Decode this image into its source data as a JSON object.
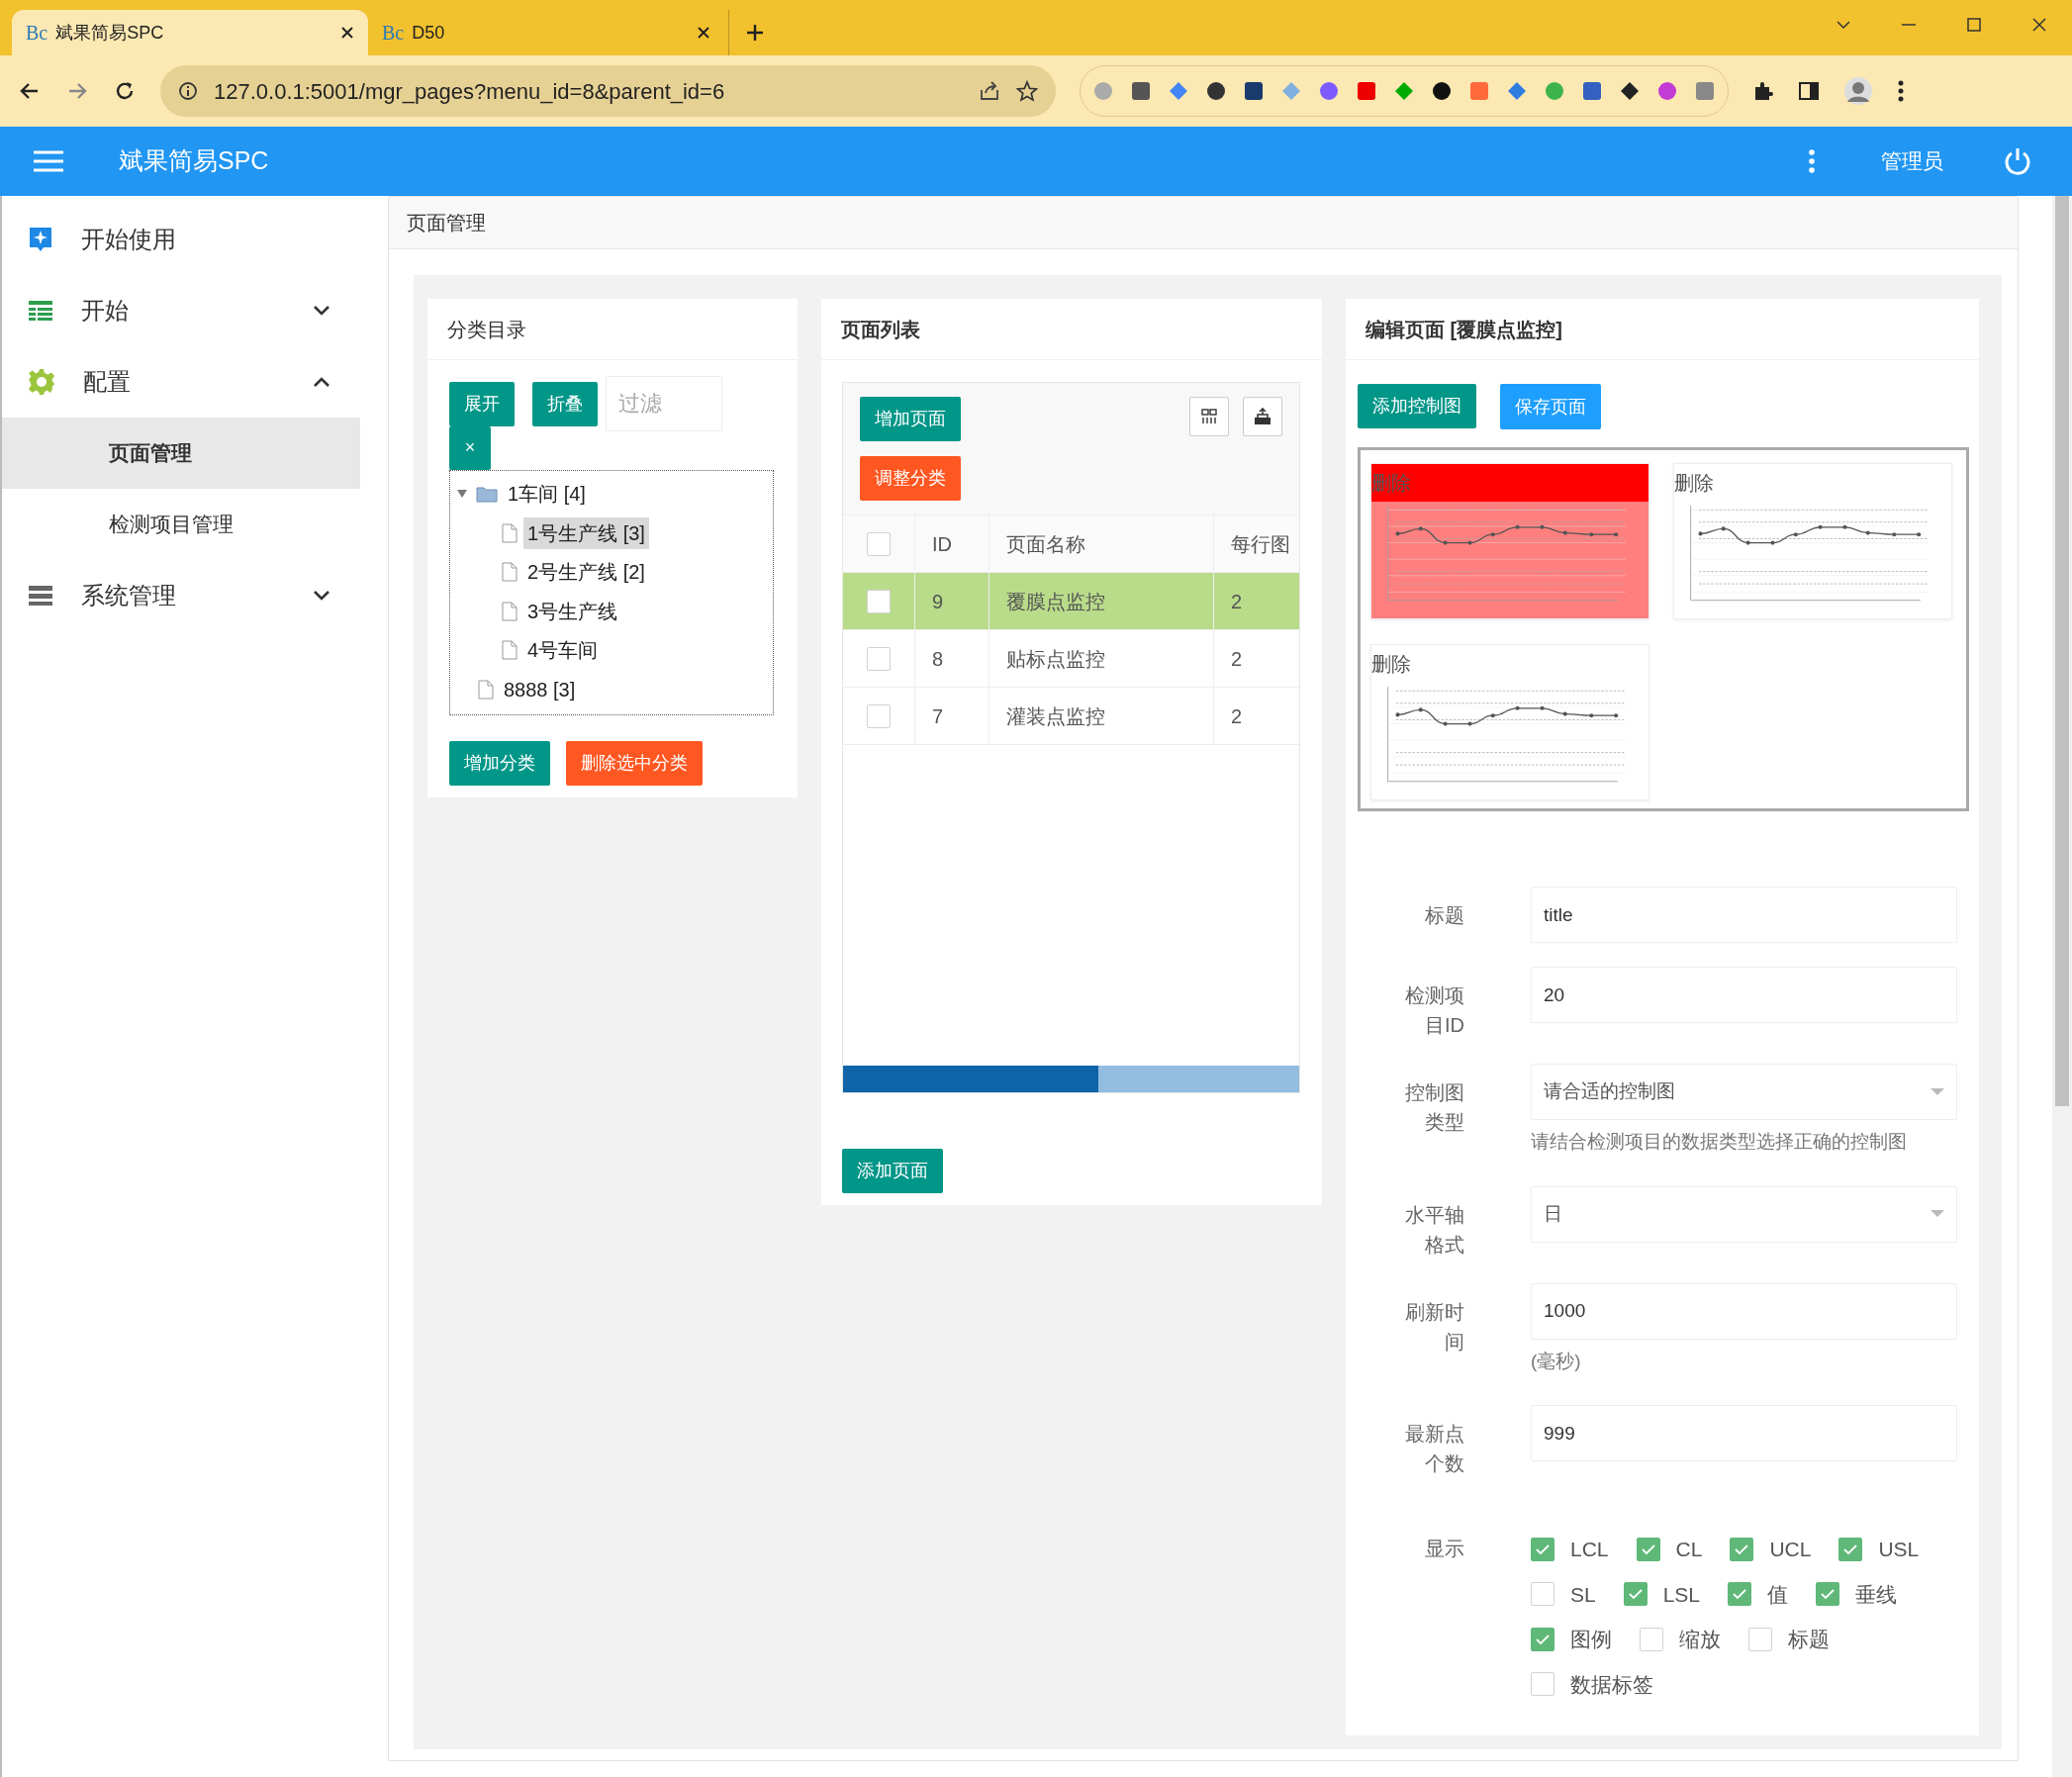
{
  "browser": {
    "tabs": [
      {
        "favicon": "Bc",
        "label": "斌果简易SPC",
        "selected": true
      },
      {
        "favicon": "Bc",
        "label": "D50",
        "selected": false
      }
    ],
    "url": "127.0.0.1:5001/mgr_pages?menu_id=8&parent_id=6"
  },
  "app": {
    "title": "斌果简易SPC",
    "user": "管理员"
  },
  "sidebar": {
    "items": [
      {
        "label": "开始使用",
        "selected": false
      },
      {
        "label": "开始",
        "selected": false,
        "expanded": false
      },
      {
        "label": "配置",
        "selected": false,
        "expanded": true,
        "children": [
          {
            "label": "页面管理",
            "selected": true
          },
          {
            "label": "检测项目管理",
            "selected": false
          }
        ]
      },
      {
        "label": "系统管理",
        "selected": false,
        "expanded": false
      }
    ]
  },
  "panel_title": "页面管理",
  "category": {
    "title": "分类目录",
    "buttons": [
      "展开",
      "折叠"
    ],
    "filter_placeholder": "过滤",
    "clear": "×",
    "tree": [
      {
        "label": "1车间 [4]",
        "selected": false,
        "expanded": true,
        "children": [
          {
            "label": "1号生产线 [3]",
            "selected": true
          },
          {
            "label": "2号生产线 [2]",
            "selected": false
          },
          {
            "label": "3号生产线",
            "selected": false
          },
          {
            "label": "4号车间",
            "selected": false
          }
        ]
      },
      {
        "label": "8888 [3]",
        "selected": false
      }
    ],
    "actions": [
      "增加分类",
      "删除选中分类"
    ]
  },
  "page_list": {
    "title": "页面列表",
    "add": "增加页面",
    "adjust": "调整分类",
    "all_checked": false,
    "columns": [
      "ID",
      "页面名称",
      "每行图"
    ],
    "rows": [
      {
        "id": "9",
        "name": "覆膜点监控",
        "per_row": "2",
        "selected": true,
        "checked": false
      },
      {
        "id": "8",
        "name": "贴标点监控",
        "per_row": "2",
        "selected": false,
        "checked": false
      },
      {
        "id": "7",
        "name": "灌装点监控",
        "per_row": "2",
        "selected": false,
        "checked": false
      }
    ],
    "footer_button": "添加页面"
  },
  "editor": {
    "title": "编辑页面 [覆膜点监控]",
    "buttons": [
      "添加控制图",
      "保存页面"
    ],
    "charts": [
      {
        "delete": "删除",
        "selected": true
      },
      {
        "delete": "删除",
        "selected": false
      },
      {
        "delete": "删除",
        "selected": false
      }
    ],
    "fields": [
      {
        "label": "标题",
        "kind": "input",
        "value": "title"
      },
      {
        "label": "检测项目ID",
        "kind": "input",
        "value": "20"
      },
      {
        "label": "控制图类型",
        "kind": "select",
        "value": "请合适的控制图",
        "help": "请结合检测项目的数据类型选择正确的控制图"
      },
      {
        "label": "水平轴格式",
        "kind": "select",
        "value": "日"
      },
      {
        "label": "刷新时间",
        "kind": "input",
        "value": "1000",
        "help": "(毫秒)"
      },
      {
        "label": "最新点个数",
        "kind": "input",
        "value": "999"
      }
    ],
    "display": {
      "label": "显示",
      "rows": [
        {
          "options": [
            {
              "label": "LCL",
              "checked": true
            },
            {
              "label": "CL",
              "checked": true
            },
            {
              "label": "UCL",
              "checked": true
            },
            {
              "label": "USL",
              "checked": true
            }
          ]
        },
        {
          "options": [
            {
              "label": "SL",
              "checked": false
            },
            {
              "label": "LSL",
              "checked": true
            },
            {
              "label": "值",
              "checked": true
            },
            {
              "label": "垂线",
              "checked": true
            }
          ]
        },
        {
          "options": [
            {
              "label": "图例",
              "checked": true
            },
            {
              "label": "缩放",
              "checked": false
            },
            {
              "label": "标题",
              "checked": false
            }
          ]
        },
        {
          "options": [
            {
              "label": "数据标签",
              "checked": false
            }
          ]
        }
      ]
    }
  }
}
